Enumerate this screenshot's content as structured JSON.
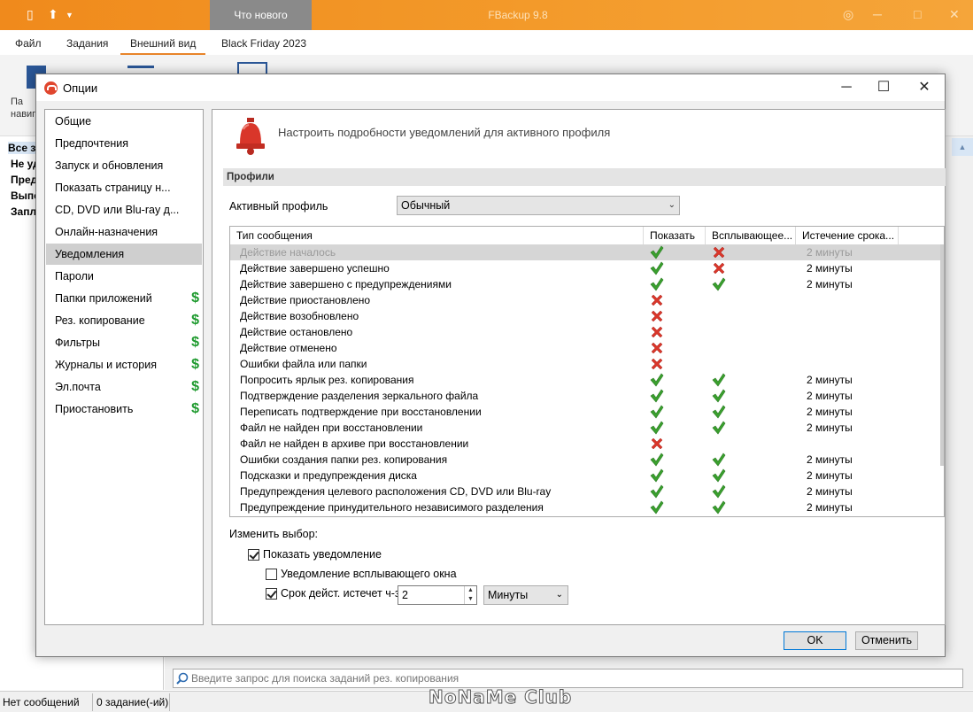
{
  "app": {
    "title": "FBackup 9.8",
    "whats_new_tab": "Что нового",
    "menu": [
      "Файл",
      "Задания",
      "Внешний вид",
      "Black Friday 2023"
    ],
    "ribbon_partial_label": "Па навиг",
    "left_rows": [
      "Все з",
      "Не уд",
      "Пред",
      "Выпо",
      "Запла"
    ],
    "search_placeholder": "Введите запрос для поиска заданий рез. копирования",
    "status": {
      "messages": "Нет сообщений",
      "jobs": "0 задание(-ий)"
    },
    "watermark": "NoNaMe Club",
    "accent_color": "#f08a1c"
  },
  "dialog": {
    "title": "Опции",
    "nav": [
      {
        "label": "Общие",
        "paid": false
      },
      {
        "label": "Предпочтения",
        "paid": false
      },
      {
        "label": "Запуск и обновления",
        "paid": false
      },
      {
        "label": "Показать страницу н...",
        "paid": false
      },
      {
        "label": "CD, DVD или Blu-ray д...",
        "paid": false
      },
      {
        "label": "Онлайн-назначения",
        "paid": false
      },
      {
        "label": "Уведомления",
        "paid": false,
        "selected": true
      },
      {
        "label": "Пароли",
        "paid": false
      },
      {
        "label": "Папки приложений",
        "paid": true
      },
      {
        "label": "Рез. копирование",
        "paid": true
      },
      {
        "label": "Фильтры",
        "paid": true
      },
      {
        "label": "Журналы и история",
        "paid": true
      },
      {
        "label": "Эл.почта",
        "paid": true
      },
      {
        "label": "Приостановить",
        "paid": true
      }
    ],
    "paid_icon": "dollar-icon",
    "header_text": "Настроить подробности уведомлений для активного профиля",
    "section_title": "Профили",
    "active_profile_label": "Активный профиль",
    "active_profile_value": "Обычный",
    "columns": [
      "Тип сообщения",
      "Показать",
      "Всплывающее...",
      "Истечение срока..."
    ],
    "rows": [
      {
        "name": "Действие началось",
        "show": "yes",
        "popup": "no",
        "expire": "2 минуты",
        "disabled": true
      },
      {
        "name": "Действие завершено успешно",
        "show": "yes",
        "popup": "no",
        "expire": "2 минуты"
      },
      {
        "name": "Действие завершено с предупреждениями",
        "show": "yes",
        "popup": "yes",
        "expire": "2 минуты"
      },
      {
        "name": "Действие приостановлено",
        "show": "no",
        "popup": "",
        "expire": ""
      },
      {
        "name": "Действие возобновлено",
        "show": "no",
        "popup": "",
        "expire": ""
      },
      {
        "name": "Действие остановлено",
        "show": "no",
        "popup": "",
        "expire": ""
      },
      {
        "name": "Действие отменено",
        "show": "no",
        "popup": "",
        "expire": ""
      },
      {
        "name": "Ошибки файла или папки",
        "show": "no",
        "popup": "",
        "expire": ""
      },
      {
        "name": "Попросить ярлык рез. копирования",
        "show": "yes",
        "popup": "yes",
        "expire": "2 минуты"
      },
      {
        "name": "Подтверждение разделения зеркального файла",
        "show": "yes",
        "popup": "yes",
        "expire": "2 минуты"
      },
      {
        "name": "Переписать подтверждение при восстановлении",
        "show": "yes",
        "popup": "yes",
        "expire": "2 минуты"
      },
      {
        "name": "Файл не найден при восстановлении",
        "show": "yes",
        "popup": "yes",
        "expire": "2 минуты"
      },
      {
        "name": "Файл не найден в архиве при восстановлении",
        "show": "no",
        "popup": "",
        "expire": ""
      },
      {
        "name": "Ошибки создания папки рез. копирования",
        "show": "yes",
        "popup": "yes",
        "expire": "2 минуты"
      },
      {
        "name": "Подсказки и предупреждения диска",
        "show": "yes",
        "popup": "yes",
        "expire": "2 минуты"
      },
      {
        "name": "Предупреждения целевого расположения CD, DVD или Blu-ray",
        "show": "yes",
        "popup": "yes",
        "expire": "2 минуты"
      },
      {
        "name": "Предупреждение принудительного независимого разделения",
        "show": "yes",
        "popup": "yes",
        "expire": "2 минуты"
      }
    ],
    "change_label": "Изменить выбор:",
    "show_notification": {
      "label": "Показать уведомление",
      "checked": true
    },
    "popup_notification": {
      "label": "Уведомление всплывающего окна",
      "checked": false
    },
    "expire_option": {
      "label": "Срок дейст. истечет ч-з",
      "checked": true,
      "value": "2",
      "unit": "Минуты"
    },
    "ok_label": "OK",
    "cancel_label": "Отменить",
    "colors": {
      "check": "#3aa02e",
      "cross": "#d9362a",
      "paid": "#1e9a2e",
      "bell": "#d9362a"
    }
  }
}
